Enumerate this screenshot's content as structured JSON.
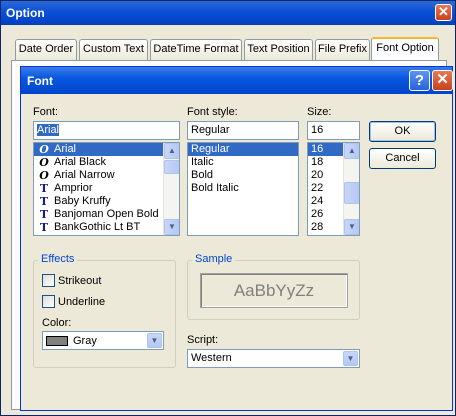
{
  "outer_window": {
    "title": "Option",
    "close_glyph": "✕"
  },
  "tabs": [
    {
      "label": "Date Order"
    },
    {
      "label": "Custom Text"
    },
    {
      "label": "DateTime Format"
    },
    {
      "label": "Text Position"
    },
    {
      "label": "File Prefix"
    },
    {
      "label": "Font Option"
    }
  ],
  "active_tab": "Font Option",
  "dialog": {
    "title": "Font",
    "help_glyph": "?",
    "close_glyph": "✕",
    "font": {
      "label": "Font:",
      "value": "Arial",
      "items": [
        {
          "name": "Arial",
          "icon": "O"
        },
        {
          "name": "Arial Black",
          "icon": "O"
        },
        {
          "name": "Arial Narrow",
          "icon": "O"
        },
        {
          "name": "Amprior",
          "icon": "T"
        },
        {
          "name": "Baby Kruffy",
          "icon": "T"
        },
        {
          "name": "Banjoman Open Bold",
          "icon": "T"
        },
        {
          "name": "BankGothic Lt BT",
          "icon": "T"
        }
      ],
      "selected": "Arial"
    },
    "style": {
      "label": "Font style:",
      "value": "Regular",
      "items": [
        "Regular",
        "Italic",
        "Bold",
        "Bold Italic"
      ],
      "selected": "Regular"
    },
    "size": {
      "label": "Size:",
      "value": "16",
      "items": [
        "16",
        "18",
        "20",
        "22",
        "24",
        "26",
        "28"
      ],
      "selected": "16"
    },
    "ok_label": "OK",
    "cancel_label": "Cancel",
    "effects": {
      "title": "Effects",
      "strikeout_label": "Strikeout",
      "underline_label": "Underline",
      "strikeout_checked": false,
      "underline_checked": false,
      "color_label": "Color:",
      "color_value": "Gray",
      "color_hex": "#808080"
    },
    "sample": {
      "title": "Sample",
      "text": "AaBbYyZz"
    },
    "script": {
      "label": "Script:",
      "value": "Western"
    }
  }
}
